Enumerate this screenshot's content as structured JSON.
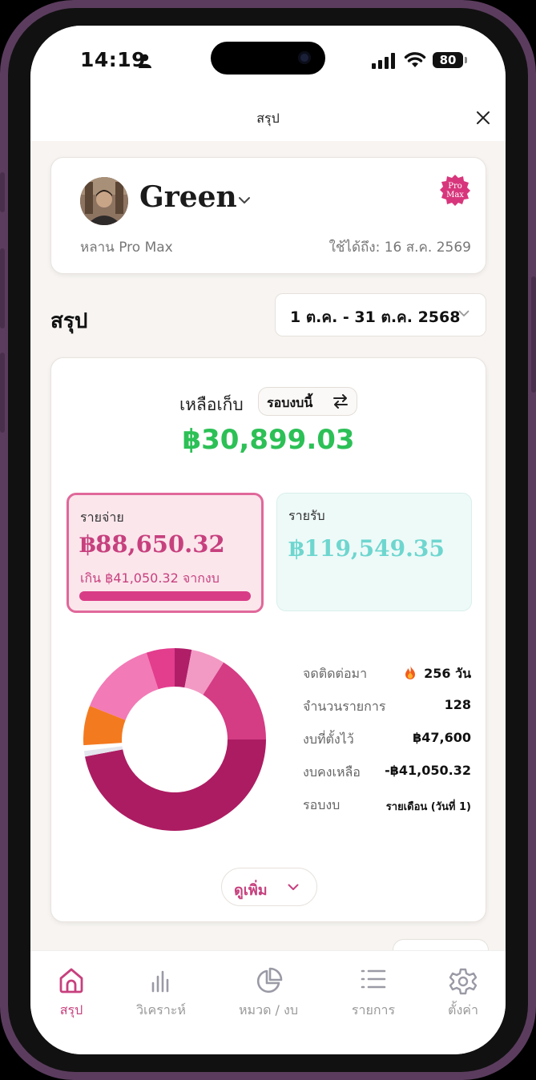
{
  "status_bar": {
    "time": "14:19",
    "battery": "80"
  },
  "header": {
    "title": "สรุป"
  },
  "profile": {
    "name": "Green",
    "plan": "หลาน Pro Max",
    "valid_until": "ใช้ได้ถึง: 16 ส.ค. 2569",
    "badge_text_top": "Pro",
    "badge_text_bottom": "Max"
  },
  "summary_section": {
    "title": "สรุป",
    "date_range": "1 ต.ค. - 31 ต.ค. 2568"
  },
  "summary_card": {
    "remaining_label": "เหลือเก็บ",
    "cycle_toggle": "รอบงบนี้",
    "remaining_value": "฿30,899.03",
    "expense": {
      "label": "รายจ่าย",
      "value": "฿88,650.32",
      "over_text": "เกิน ฿41,050.32 จากงบ",
      "over_fraction": 1.0
    },
    "income": {
      "label": "รายรับ",
      "value": "฿119,549.35"
    },
    "stats": [
      {
        "label": "จดติดต่อมา",
        "value": "256 วัน"
      },
      {
        "label": "จำนวนรายการ",
        "value": "128"
      },
      {
        "label": "งบที่ตั้งไว้",
        "value": "฿47,600"
      },
      {
        "label": "งบคงเหลือ",
        "value": "-฿41,050.32"
      },
      {
        "label": "รอบงบ",
        "value": "รายเดือน (วันที่ 1)"
      }
    ],
    "more_button": "ดูเพิ่ม"
  },
  "chart_data": {
    "type": "pie",
    "variant": "donut",
    "values": [
      0.03,
      0.06,
      0.16,
      0.47,
      0.01,
      0.01,
      0.07,
      0.14,
      0.05
    ],
    "colors": [
      "#b01e68",
      "#f29ac4",
      "#d43c84",
      "#ac1c62",
      "#e5e5ee",
      "#ffffff",
      "#f47a1f",
      "#f27ab6",
      "#e33d8e"
    ]
  },
  "tabbar": {
    "tabs": [
      {
        "label": "สรุป",
        "icon": "home-icon",
        "active": true
      },
      {
        "label": "วิเคราะห์",
        "icon": "bar-chart-icon",
        "active": false
      },
      {
        "label": "หมวด / งบ",
        "icon": "pie-chart-icon",
        "active": false
      },
      {
        "label": "รายการ",
        "icon": "list-icon",
        "active": false
      },
      {
        "label": "ตั้งค่า",
        "icon": "gear-icon",
        "active": false
      }
    ]
  },
  "colors": {
    "accent": "#c7407e",
    "positive": "#2cc056",
    "income": "#6ed6cf"
  }
}
